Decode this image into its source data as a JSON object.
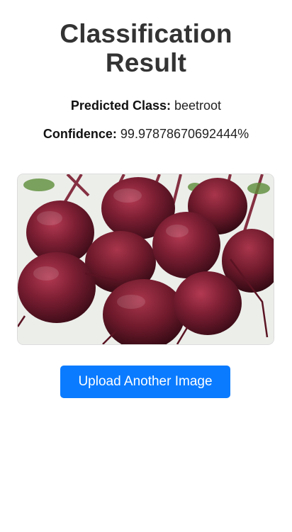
{
  "header": {
    "title_line1": "Classification",
    "title_line2": "Result"
  },
  "result": {
    "predicted_label": "Predicted Class:",
    "predicted_value": "beetroot",
    "confidence_label": "Confidence:",
    "confidence_value": "99.97878670692444%"
  },
  "image": {
    "subject": "beetroot"
  },
  "actions": {
    "upload_label": "Upload Another Image"
  },
  "colors": {
    "accent": "#0a7bff",
    "title": "#333333"
  }
}
